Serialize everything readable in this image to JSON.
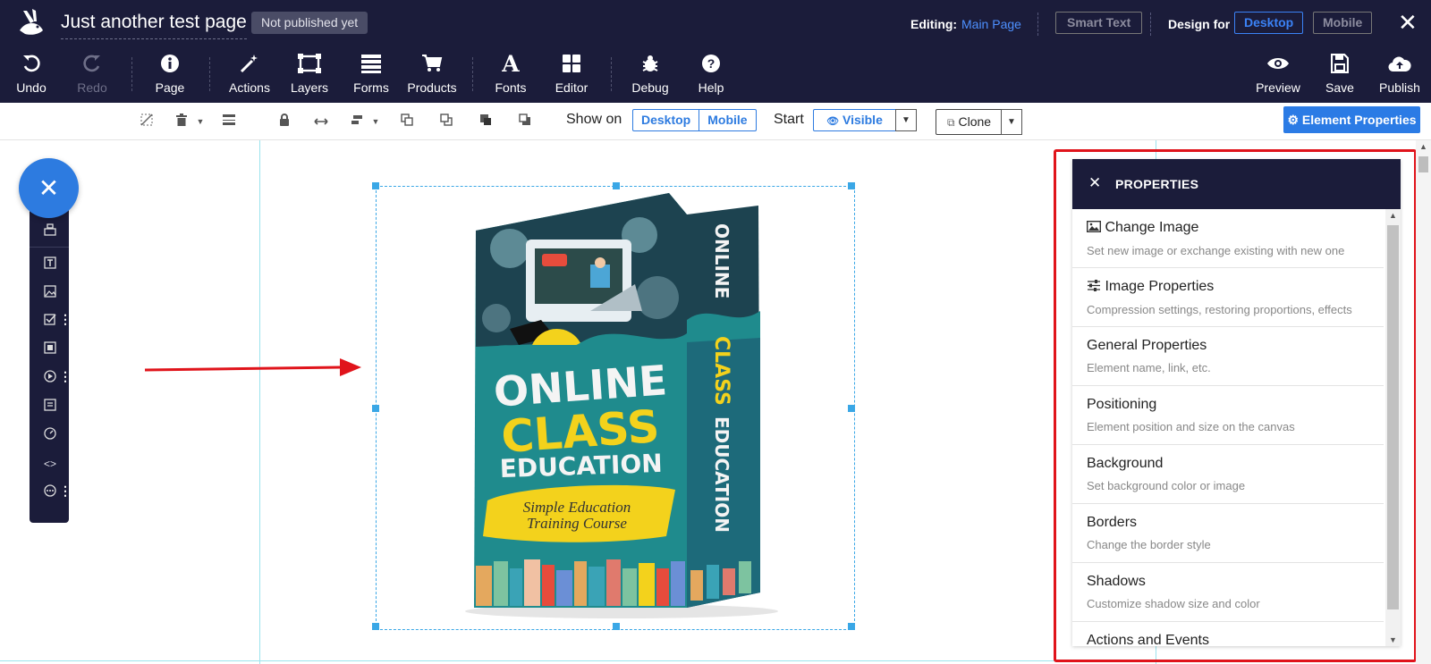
{
  "app": {
    "page_title": "Just another test page",
    "publish_status": "Not published yet",
    "editing_label": "Editing:",
    "editing_page": "Main Page",
    "smart_text": "Smart Text",
    "design_for_label": "Design for",
    "design_desktop": "Desktop",
    "design_mobile": "Mobile",
    "close_glyph": "✕"
  },
  "toolbar": {
    "undo": "Undo",
    "redo": "Redo",
    "page": "Page",
    "actions": "Actions",
    "layers": "Layers",
    "forms": "Forms",
    "products": "Products",
    "fonts": "Fonts",
    "editor": "Editor",
    "debug": "Debug",
    "help": "Help",
    "preview": "Preview",
    "save": "Save",
    "publish": "Publish"
  },
  "element_bar": {
    "show_on_label": "Show on",
    "show_desktop": "Desktop",
    "show_mobile": "Mobile",
    "start_label": "Start",
    "visible_label": "Visible",
    "clone_label": "Clone",
    "element_properties": "Element Properties"
  },
  "product_image": {
    "line1": "ONLINE",
    "line2": "CLASS",
    "line3": "EDUCATION",
    "tagline1": "Simple Education",
    "tagline2": "Training Course",
    "spine1": "ONLINE",
    "spine2": "CLASS",
    "spine3": "EDUCATION"
  },
  "properties_panel": {
    "title": "PROPERTIES",
    "items": [
      {
        "title": "Change Image",
        "desc": "Set new image or exchange existing with new one"
      },
      {
        "title": "Image Properties",
        "desc": "Compression settings, restoring proportions, effects"
      },
      {
        "title": "General Properties",
        "desc": "Element name, link, etc."
      },
      {
        "title": "Positioning",
        "desc": "Element position and size on the canvas"
      },
      {
        "title": "Background",
        "desc": "Set background color or image"
      },
      {
        "title": "Borders",
        "desc": "Change the border style"
      },
      {
        "title": "Shadows",
        "desc": "Customize shadow size and color"
      },
      {
        "title": "Actions and Events",
        "desc": ""
      }
    ]
  },
  "colors": {
    "topbar": "#1b1c3a",
    "accent_blue": "#2d7be0",
    "annotation_red": "#e0141b",
    "guide_cyan": "#9be4ee",
    "box_teal": "#1e8a8a",
    "box_yellow": "#f3d21c"
  }
}
